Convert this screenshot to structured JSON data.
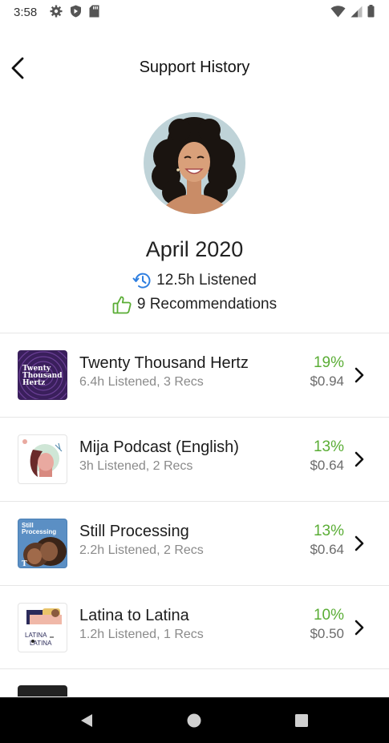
{
  "status_bar": {
    "time": "3:58"
  },
  "header": {
    "title": "Support History"
  },
  "summary": {
    "month": "April 2020",
    "listened": "12.5h Listened",
    "recommendations": "9 Recommendations"
  },
  "podcasts": [
    {
      "title": "Twenty Thousand Hertz",
      "stats": "6.4h Listened, 3 Recs",
      "percent": "19%",
      "amount": "$0.94",
      "cover_text": [
        "Twenty",
        "Thousand",
        "Hertz"
      ]
    },
    {
      "title": "Mija Podcast (English)",
      "stats": "3h Listened, 2 Recs",
      "percent": "13%",
      "amount": "$0.64"
    },
    {
      "title": "Still Processing",
      "stats": "2.2h Listened, 2 Recs",
      "percent": "13%",
      "amount": "$0.64",
      "cover_text": [
        "Still",
        "Processing"
      ]
    },
    {
      "title": "Latina to Latina",
      "stats": "1.2h Listened, 1 Recs",
      "percent": "10%",
      "amount": "$0.50",
      "cover_text": [
        "LATINA",
        "LATINA"
      ]
    }
  ],
  "colors": {
    "accent_green": "#5aad35",
    "accent_blue": "#2f7fe0",
    "nav_bar": "#000000"
  },
  "icons": [
    "settings-icon",
    "shield-icon",
    "sd-card-icon",
    "wifi-icon",
    "signal-icon",
    "battery-icon",
    "back-arrow-icon",
    "history-clock-icon",
    "thumbs-up-icon",
    "chevron-right-icon",
    "nav-back-icon",
    "nav-home-icon",
    "nav-recents-icon"
  ]
}
